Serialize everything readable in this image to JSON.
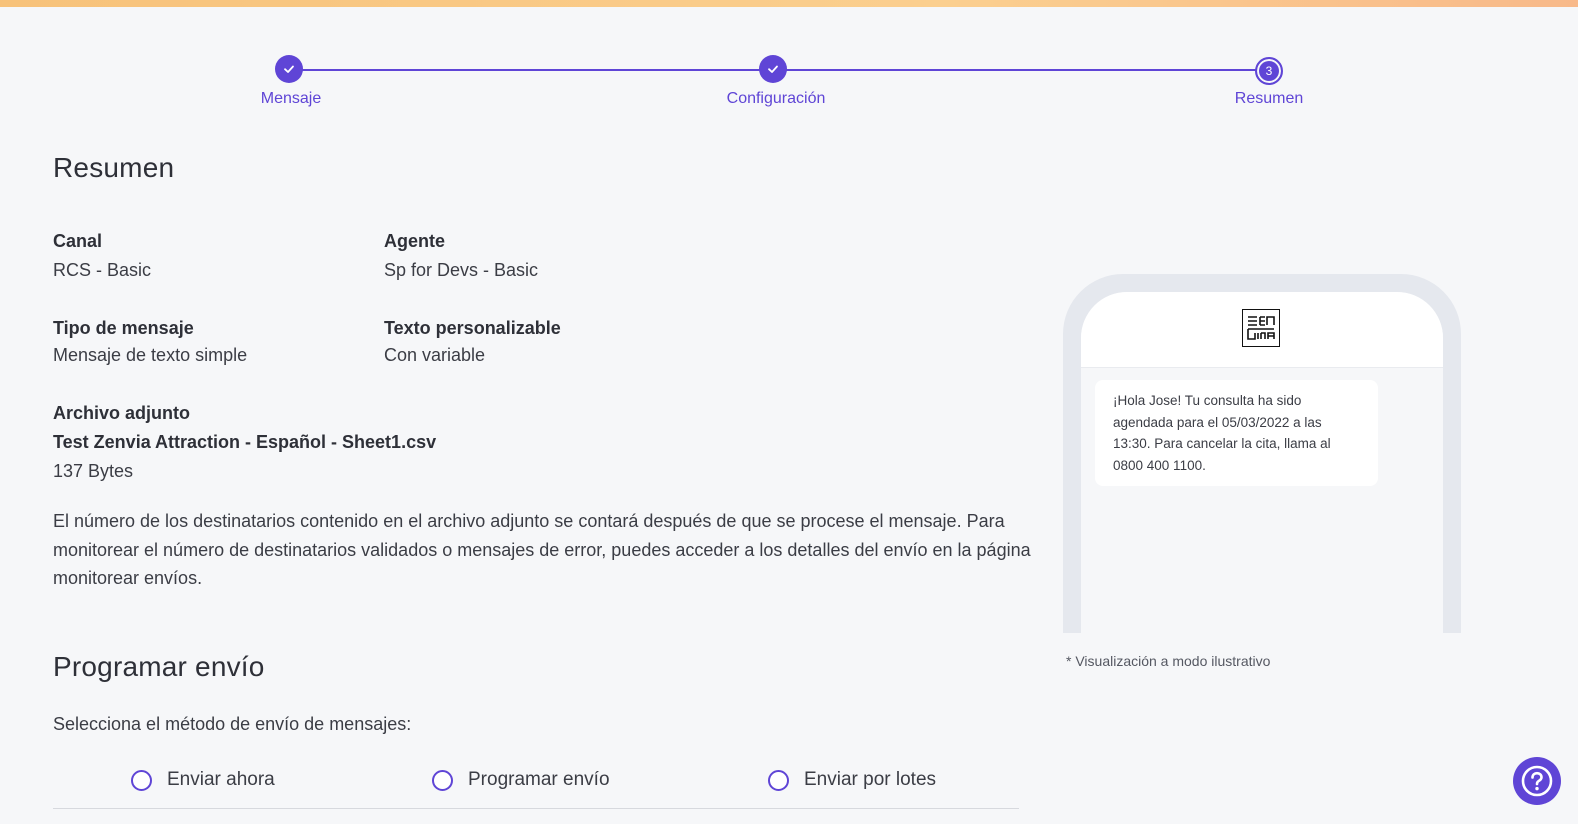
{
  "stepper": {
    "steps": [
      {
        "label": "Mensaje",
        "state": "done"
      },
      {
        "label": "Configuración",
        "state": "done"
      },
      {
        "label": "Resumen",
        "state": "current",
        "number": "3"
      }
    ]
  },
  "summary": {
    "title": "Resumen",
    "canal_label": "Canal",
    "canal_value": "RCS - Basic",
    "agente_label": "Agente",
    "agente_value": "Sp for Devs - Basic",
    "tipo_label": "Tipo de mensaje",
    "tipo_value": "Mensaje de texto simple",
    "texto_label": "Texto personalizable",
    "texto_value": "Con variable",
    "archivo_label": "Archivo adjunto",
    "archivo_name": "Test Zenvia Attraction - Español - Sheet1.csv",
    "archivo_size": "137 Bytes",
    "info_text": "El número de los destinatarios contenido en el archivo adjunto se contará después de que se procese el mensaje. Para monitorear el número de destinatarios validados o mensajes de error, puedes acceder a los detalles del envío en la página monitorear envíos."
  },
  "schedule": {
    "title": "Programar envío",
    "select_label": "Selecciona el método de envío de mensajes:",
    "options": [
      "Enviar ahora",
      "Programar envío",
      "Enviar por lotes"
    ]
  },
  "preview": {
    "message": "¡Hola Jose! Tu consulta ha sido agendada para el 05/03/2022 a las 13:30. Para cancelar la cita, llama al 0800 400 1100.",
    "note": "* Visualización a modo ilustrativo"
  },
  "colors": {
    "accent": "#5f45d6",
    "topbar": "#f7c27a"
  },
  "icons": {
    "step_done": "check-icon",
    "help": "help-icon",
    "logo": "zenvia-logo"
  }
}
